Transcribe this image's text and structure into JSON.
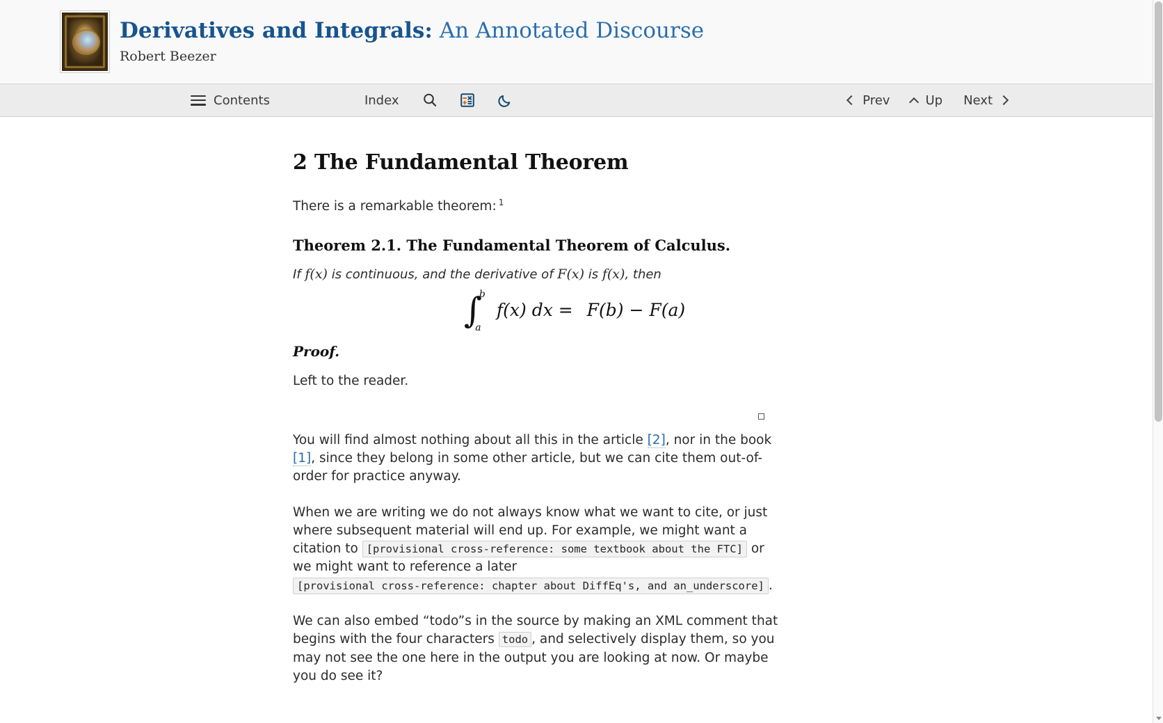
{
  "masthead": {
    "logo_alt": "ornate-book-cover",
    "title_main": "Derivatives and Integrals:",
    "title_sub": "An Annotated Discourse",
    "author": "Robert Beezer",
    "accent_color": "#1d5b9e"
  },
  "toolbar": {
    "contents_label": "Contents",
    "index_label": "Index",
    "search_icon": "search-icon",
    "calculator_icon": "calculator-icon",
    "darkmode_icon": "moon-icon",
    "prev_label": "Prev",
    "up_label": "Up",
    "next_label": "Next",
    "background": "#ececec"
  },
  "article": {
    "section_number": "2",
    "section_title": "2 The Fundamental Theorem",
    "intro": "There is a remarkable theorem:",
    "footnote_marker": "1",
    "theorem": {
      "title": "Theorem 2.1. The Fundamental Theorem of Calculus.",
      "statement_a": "If",
      "statement_fx1": "f(x)",
      "statement_b": "is continuous, and the derivative of",
      "statement_Fx": "F(x)",
      "statement_c": "is",
      "statement_fx2": "f(x)",
      "statement_d": ", then",
      "equation": {
        "integral_sign": "∫",
        "upper_limit": "b",
        "lower_limit": "a",
        "integrand": "f(x) dx",
        "equals": "=",
        "rhs": "F(b) − F(a)",
        "plain": "∫_a^b f(x) dx = F(b) − F(a)"
      }
    },
    "proof_heading": "Proof.",
    "proof_body": "Left to the reader.",
    "qed_symbol": "□",
    "para_citations": {
      "text_1": "You will find almost nothing about all this in the article ",
      "cite_1": "[2]",
      "text_2": ", nor in the book ",
      "cite_2": "[1]",
      "text_3": ", since they belong in some other article, but we can cite them out-of-order for practice anyway."
    },
    "para_provisional": {
      "text_1": "When we are writing we do not always know what we want to cite, or just where subsequent material will end up. For example, we might want a citation to ",
      "code_1": "[provisional cross-reference: some textbook about the FTC]",
      "text_2": " or we might want to reference a later ",
      "code_2": "[provisional cross-reference: chapter about DiffEq's, and an_underscore]",
      "text_3": "."
    },
    "para_todo": {
      "text_1": "We can also embed “todo”s in the source by making an XML comment that begins with the four characters ",
      "code_1": "todo",
      "text_2": ", and selectively display them, so you may not see the one here in the output you are looking at now. Or maybe you do see it?"
    }
  },
  "scrollbar": {
    "position": "right",
    "thumb_visible": "true"
  }
}
